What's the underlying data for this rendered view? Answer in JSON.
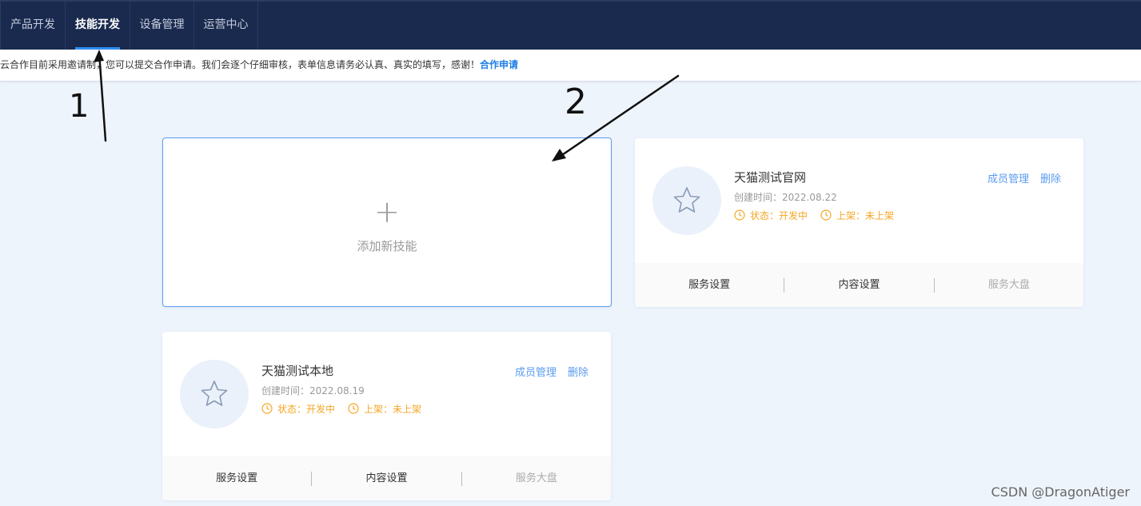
{
  "nav": {
    "items": [
      {
        "label": "产品开发",
        "active": false
      },
      {
        "label": "技能开发",
        "active": true
      },
      {
        "label": "设备管理",
        "active": false
      },
      {
        "label": "运营中心",
        "active": false
      }
    ]
  },
  "notice": {
    "text": "云合作目前采用邀请制，您可以提交合作申请。我们会逐个仔细审核，表单信息请务必认真、真实的填写，感谢！",
    "link": "合作申请"
  },
  "add_card": {
    "plus_icon": "+",
    "label": "添加新技能"
  },
  "skills": [
    {
      "name": "天猫测试官网",
      "created_label": "创建时间：",
      "created_date": "2022.08.22",
      "status": "状态：开发中",
      "release": "上架：未上架",
      "member_action": "成员管理",
      "delete_action": "删除",
      "footer": [
        "服务设置",
        "内容设置",
        "服务大盘"
      ]
    },
    {
      "name": "天猫测试本地",
      "created_label": "创建时间：",
      "created_date": "2022.08.19",
      "status": "状态：开发中",
      "release": "上架：未上架",
      "member_action": "成员管理",
      "delete_action": "删除",
      "footer": [
        "服务设置",
        "内容设置",
        "服务大盘"
      ]
    }
  ],
  "annotations": {
    "mark_1": "1",
    "mark_2": "2"
  },
  "watermark": "CSDN @DragonAtiger",
  "colors": {
    "nav_bg": "#1a2a4e",
    "accent": "#2f8ef0",
    "status_orange": "#f5a623",
    "link_blue": "#5b9cf0"
  }
}
